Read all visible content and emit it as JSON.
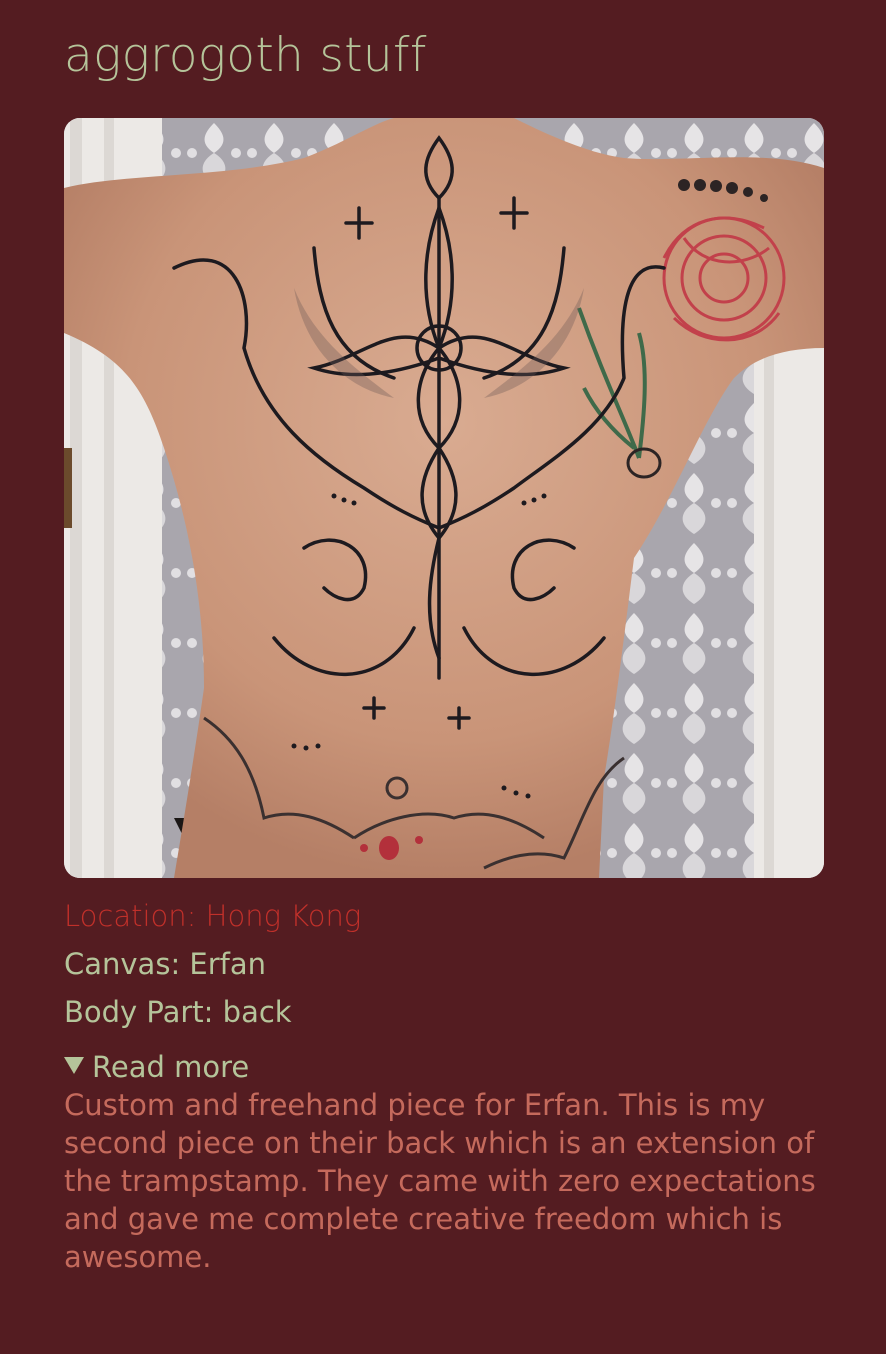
{
  "title": "aggrogoth stuff",
  "photo": {
    "subject": "back-tattoo-photo"
  },
  "details": {
    "location": "Location: Hong Kong",
    "canvas": "Canvas: Erfan",
    "body_part": "Body Part: back"
  },
  "read_more": {
    "label": "Read more",
    "expanded": true,
    "text": "Custom and freehand piece for Erfan. This is my second piece on their back which is an extension of the trampstamp. They came with zero expectations and gave me complete creative freedom which is awesome."
  },
  "colors": {
    "background": "#541c21",
    "title": "#b5c49a",
    "location": "#c1302a",
    "description": "#c56a5c"
  }
}
